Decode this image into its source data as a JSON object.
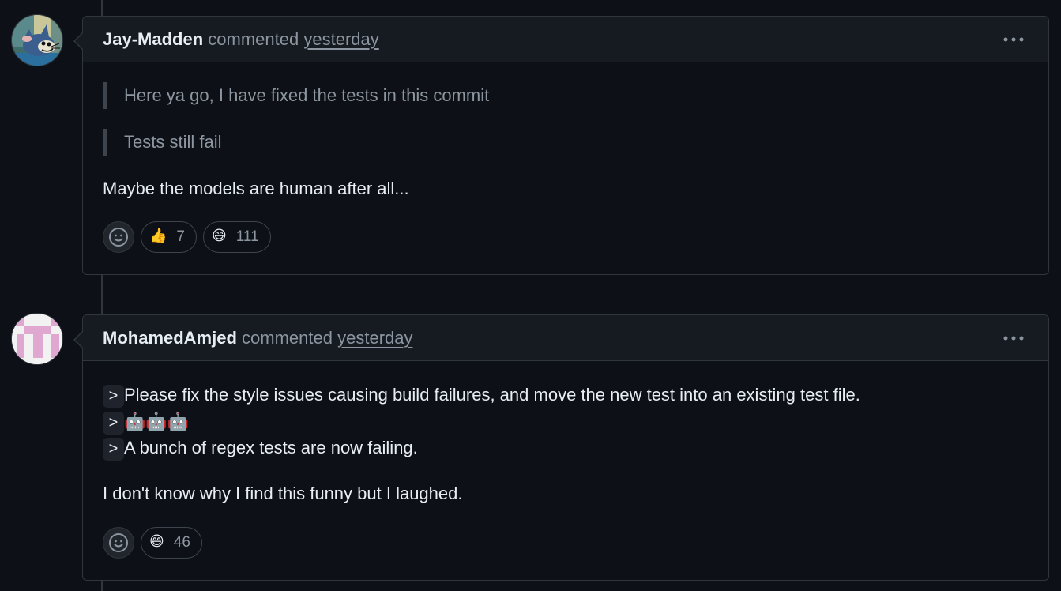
{
  "comments": [
    {
      "author": "Jay-Madden",
      "verb": "commented",
      "time": "yesterday",
      "avatar": "cartoon-cat-avatar",
      "quotes": [
        "Here ya go, I have fixed the tests in this commit",
        "Tests still fail"
      ],
      "body": "Maybe the models are human after all...",
      "reactions": [
        {
          "emoji": "👍",
          "name": "thumbs-up",
          "count": "7"
        },
        {
          "emoji": "😄",
          "name": "laugh",
          "count": "111"
        }
      ]
    },
    {
      "author": "MohamedAmjed",
      "verb": "commented",
      "time": "yesterday",
      "avatar": "pink-identicon-avatar",
      "quote_marker": ">",
      "quote_lines": [
        "Please fix the style issues causing build failures, and move the new test into an existing test file.",
        "🤖🤖🤖",
        "A bunch of regex tests are now failing."
      ],
      "body": "I don't know why I find this funny but I laughed.",
      "reactions": [
        {
          "emoji": "😄",
          "name": "laugh",
          "count": "46"
        }
      ]
    }
  ],
  "colors": {
    "background": "#0d1117",
    "header": "#161b22",
    "border": "#30363d",
    "muted_text": "#8d96a0",
    "text": "#e6edf3",
    "identicon_pink": "#e0a8d0"
  }
}
